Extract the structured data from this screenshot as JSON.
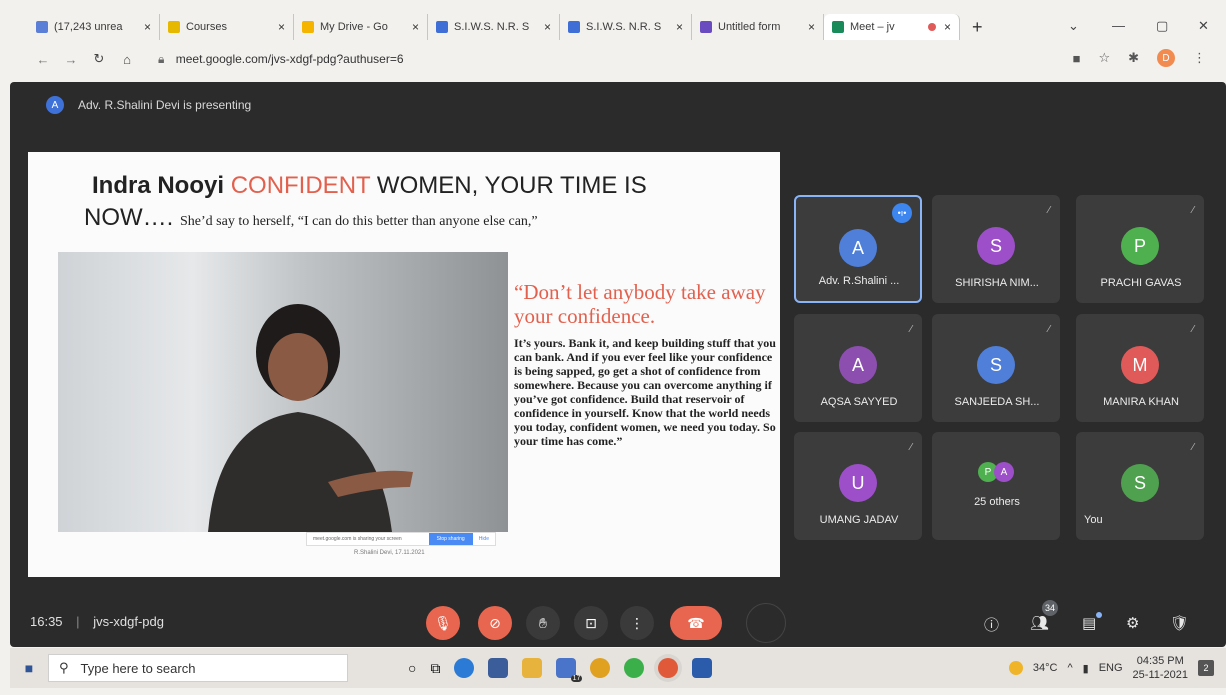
{
  "browser": {
    "tabs": [
      {
        "title": "(17,243 unrea",
        "favicon_color": "#5b7fd6",
        "active": false
      },
      {
        "title": "Courses",
        "favicon_color": "#e6b800",
        "active": false
      },
      {
        "title": "My Drive - Go",
        "favicon_color": "#f4b400",
        "active": false
      },
      {
        "title": "S.I.W.S. N.R. S",
        "favicon_color": "#3f6fd6",
        "active": false
      },
      {
        "title": "S.I.W.S. N.R. S",
        "favicon_color": "#3f6fd6",
        "active": false
      },
      {
        "title": "Untitled form",
        "favicon_color": "#6a4cc0",
        "active": false
      },
      {
        "title": "Meet – jv",
        "favicon_color": "#1a8a5a",
        "active": true
      }
    ],
    "tab_close": "×",
    "new_tab": "+",
    "url": "meet.google.com/jvs-xdgf-pdg?authuser=6",
    "profile_initial": "D",
    "minimize": "—",
    "maximize": "▢",
    "close": "✕"
  },
  "meet": {
    "presenter_initial": "A",
    "presenting_text": "Adv. R.Shalini Devi is presenting",
    "meeting_time": "16:35",
    "meeting_code": "jvs-xdgf-pdg",
    "participant_count": "34",
    "slide": {
      "title_bold": "Indra Nooyi",
      "title_highlight": "CONFIDENT",
      "title_rest": "WOMEN, YOUR TIME IS",
      "title_line2": "NOW….",
      "title_quote": "She’d say to herself, “I can do this better than anyone else can,”",
      "quote_heading": "“Don’t let anybody take away your confidence.",
      "body": "It’s yours. Bank it, and keep building stuff that you can bank. And if you ever feel like your confidence is being sapped, go get a shot of confidence from somewhere. Because you can overcome anything if you’ve got confidence. Build that reservoir of confidence in yourself. Know that the world needs you today, confident women, we need you today. So your time has come.”",
      "share_strip_text": "meet.google.com is sharing your screen",
      "share_strip_stop": "Stop sharing",
      "share_strip_hide": "Hide",
      "footer": "R.Shalini Devi, 17.11.2021"
    },
    "tiles": [
      {
        "initial": "A",
        "name": "Adv. R.Shalini ...",
        "color": "#4f7fd9",
        "speaking": true
      },
      {
        "initial": "S",
        "name": "SHIRISHA NIM...",
        "color": "#9c4fc9",
        "speaking": false
      },
      {
        "initial": "P",
        "name": "PRACHI GAVAS",
        "color": "#4fb04f",
        "speaking": false
      },
      {
        "initial": "A",
        "name": "AQSA SAYYED",
        "color": "#8c4fb0",
        "speaking": false
      },
      {
        "initial": "S",
        "name": "SANJEEDA SH...",
        "color": "#4f7fd9",
        "speaking": false
      },
      {
        "initial": "M",
        "name": "MANIRA KHAN",
        "color": "#e05a5a",
        "speaking": false
      },
      {
        "initial": "U",
        "name": "UMANG JADAV",
        "color": "#9c4fc9",
        "speaking": false
      },
      {
        "initial": "",
        "name": "25 others",
        "color": "#4fb04f",
        "speaking": false,
        "others": [
          "P",
          "A"
        ]
      },
      {
        "initial": "S",
        "name": "You",
        "color": "#4fa04f",
        "speaking": false
      }
    ]
  },
  "taskbar": {
    "search_placeholder": "Type here to search",
    "mail_badge": "17",
    "temperature": "34°C",
    "language": "ENG",
    "time": "04:35 PM",
    "date": "25-11-2021",
    "notifications": "2"
  }
}
